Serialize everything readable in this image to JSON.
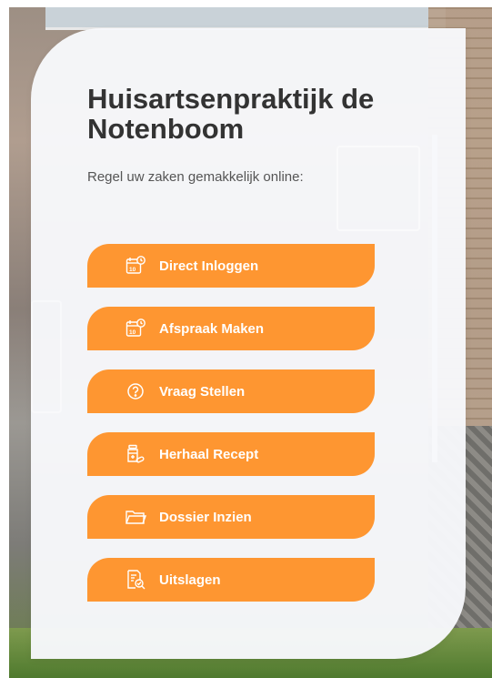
{
  "header": {
    "title": "Huisartsenpraktijk de Notenboom",
    "subtitle": "Regel uw zaken gemakkelijk online:"
  },
  "buttons": [
    {
      "label": "Direct Inloggen",
      "icon": "calendar-clock-icon"
    },
    {
      "label": "Afspraak Maken",
      "icon": "calendar-clock-icon"
    },
    {
      "label": "Vraag Stellen",
      "icon": "question-circle-icon"
    },
    {
      "label": "Herhaal Recept",
      "icon": "medicine-bottle-icon"
    },
    {
      "label": "Dossier Inzien",
      "icon": "folder-icon"
    },
    {
      "label": "Uitslagen",
      "icon": "document-search-icon"
    }
  ],
  "colors": {
    "accent": "#fe9631",
    "title": "#333333",
    "card": "#f7f8fb"
  }
}
